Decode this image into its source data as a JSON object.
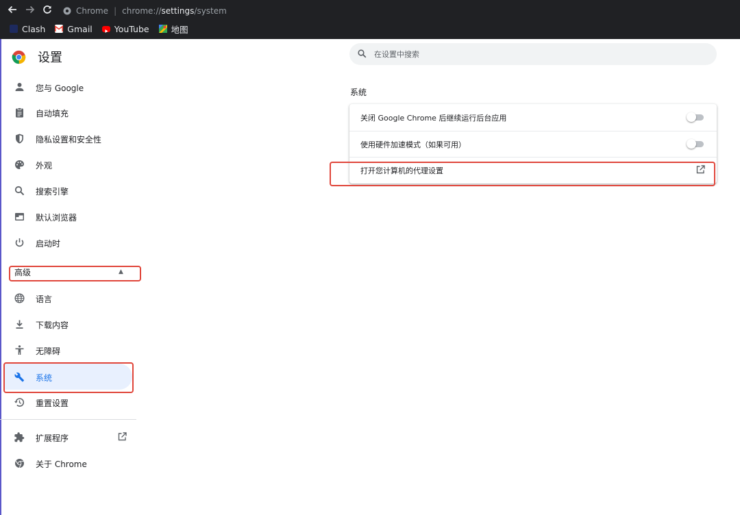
{
  "browser": {
    "site_name": "Chrome",
    "url_scheme": "chrome://",
    "url_host": "settings",
    "url_path": "/system",
    "bookmarks": [
      {
        "label": "Clash",
        "icon": "clash-icon"
      },
      {
        "label": "Gmail",
        "icon": "gmail-icon"
      },
      {
        "label": "YouTube",
        "icon": "youtube-icon"
      },
      {
        "label": "地图",
        "icon": "maps-icon"
      }
    ]
  },
  "sidebar": {
    "title": "设置",
    "items": [
      {
        "label": "您与 Google",
        "icon": "person-icon"
      },
      {
        "label": "自动填充",
        "icon": "clipboard-icon"
      },
      {
        "label": "隐私设置和安全性",
        "icon": "shield-icon"
      },
      {
        "label": "外观",
        "icon": "palette-icon"
      },
      {
        "label": "搜索引擎",
        "icon": "search-icon"
      },
      {
        "label": "默认浏览器",
        "icon": "browser-window-icon"
      },
      {
        "label": "启动时",
        "icon": "power-icon"
      }
    ],
    "advanced_label": "高级",
    "advanced_items": [
      {
        "label": "语言",
        "icon": "globe-icon"
      },
      {
        "label": "下载内容",
        "icon": "download-icon"
      },
      {
        "label": "无障碍",
        "icon": "accessibility-icon"
      },
      {
        "label": "系统",
        "icon": "wrench-icon",
        "active": true
      },
      {
        "label": "重置设置",
        "icon": "restore-icon"
      }
    ],
    "extensions_label": "扩展程序",
    "about_label": "关于 Chrome"
  },
  "main": {
    "search_placeholder": "在设置中搜索",
    "section_title": "系统",
    "rows": [
      {
        "label": "关闭 Google Chrome 后继续运行后台应用",
        "control": "toggle",
        "checked": false
      },
      {
        "label": "使用硬件加速模式（如果可用）",
        "control": "toggle",
        "checked": false
      },
      {
        "label": "打开您计算机的代理设置",
        "control": "external-link"
      }
    ]
  },
  "colors": {
    "accent": "#1a73e8",
    "active_bg": "#e8f0fe",
    "highlight_box": "#e0453a",
    "toolbar_bg": "#202124"
  }
}
